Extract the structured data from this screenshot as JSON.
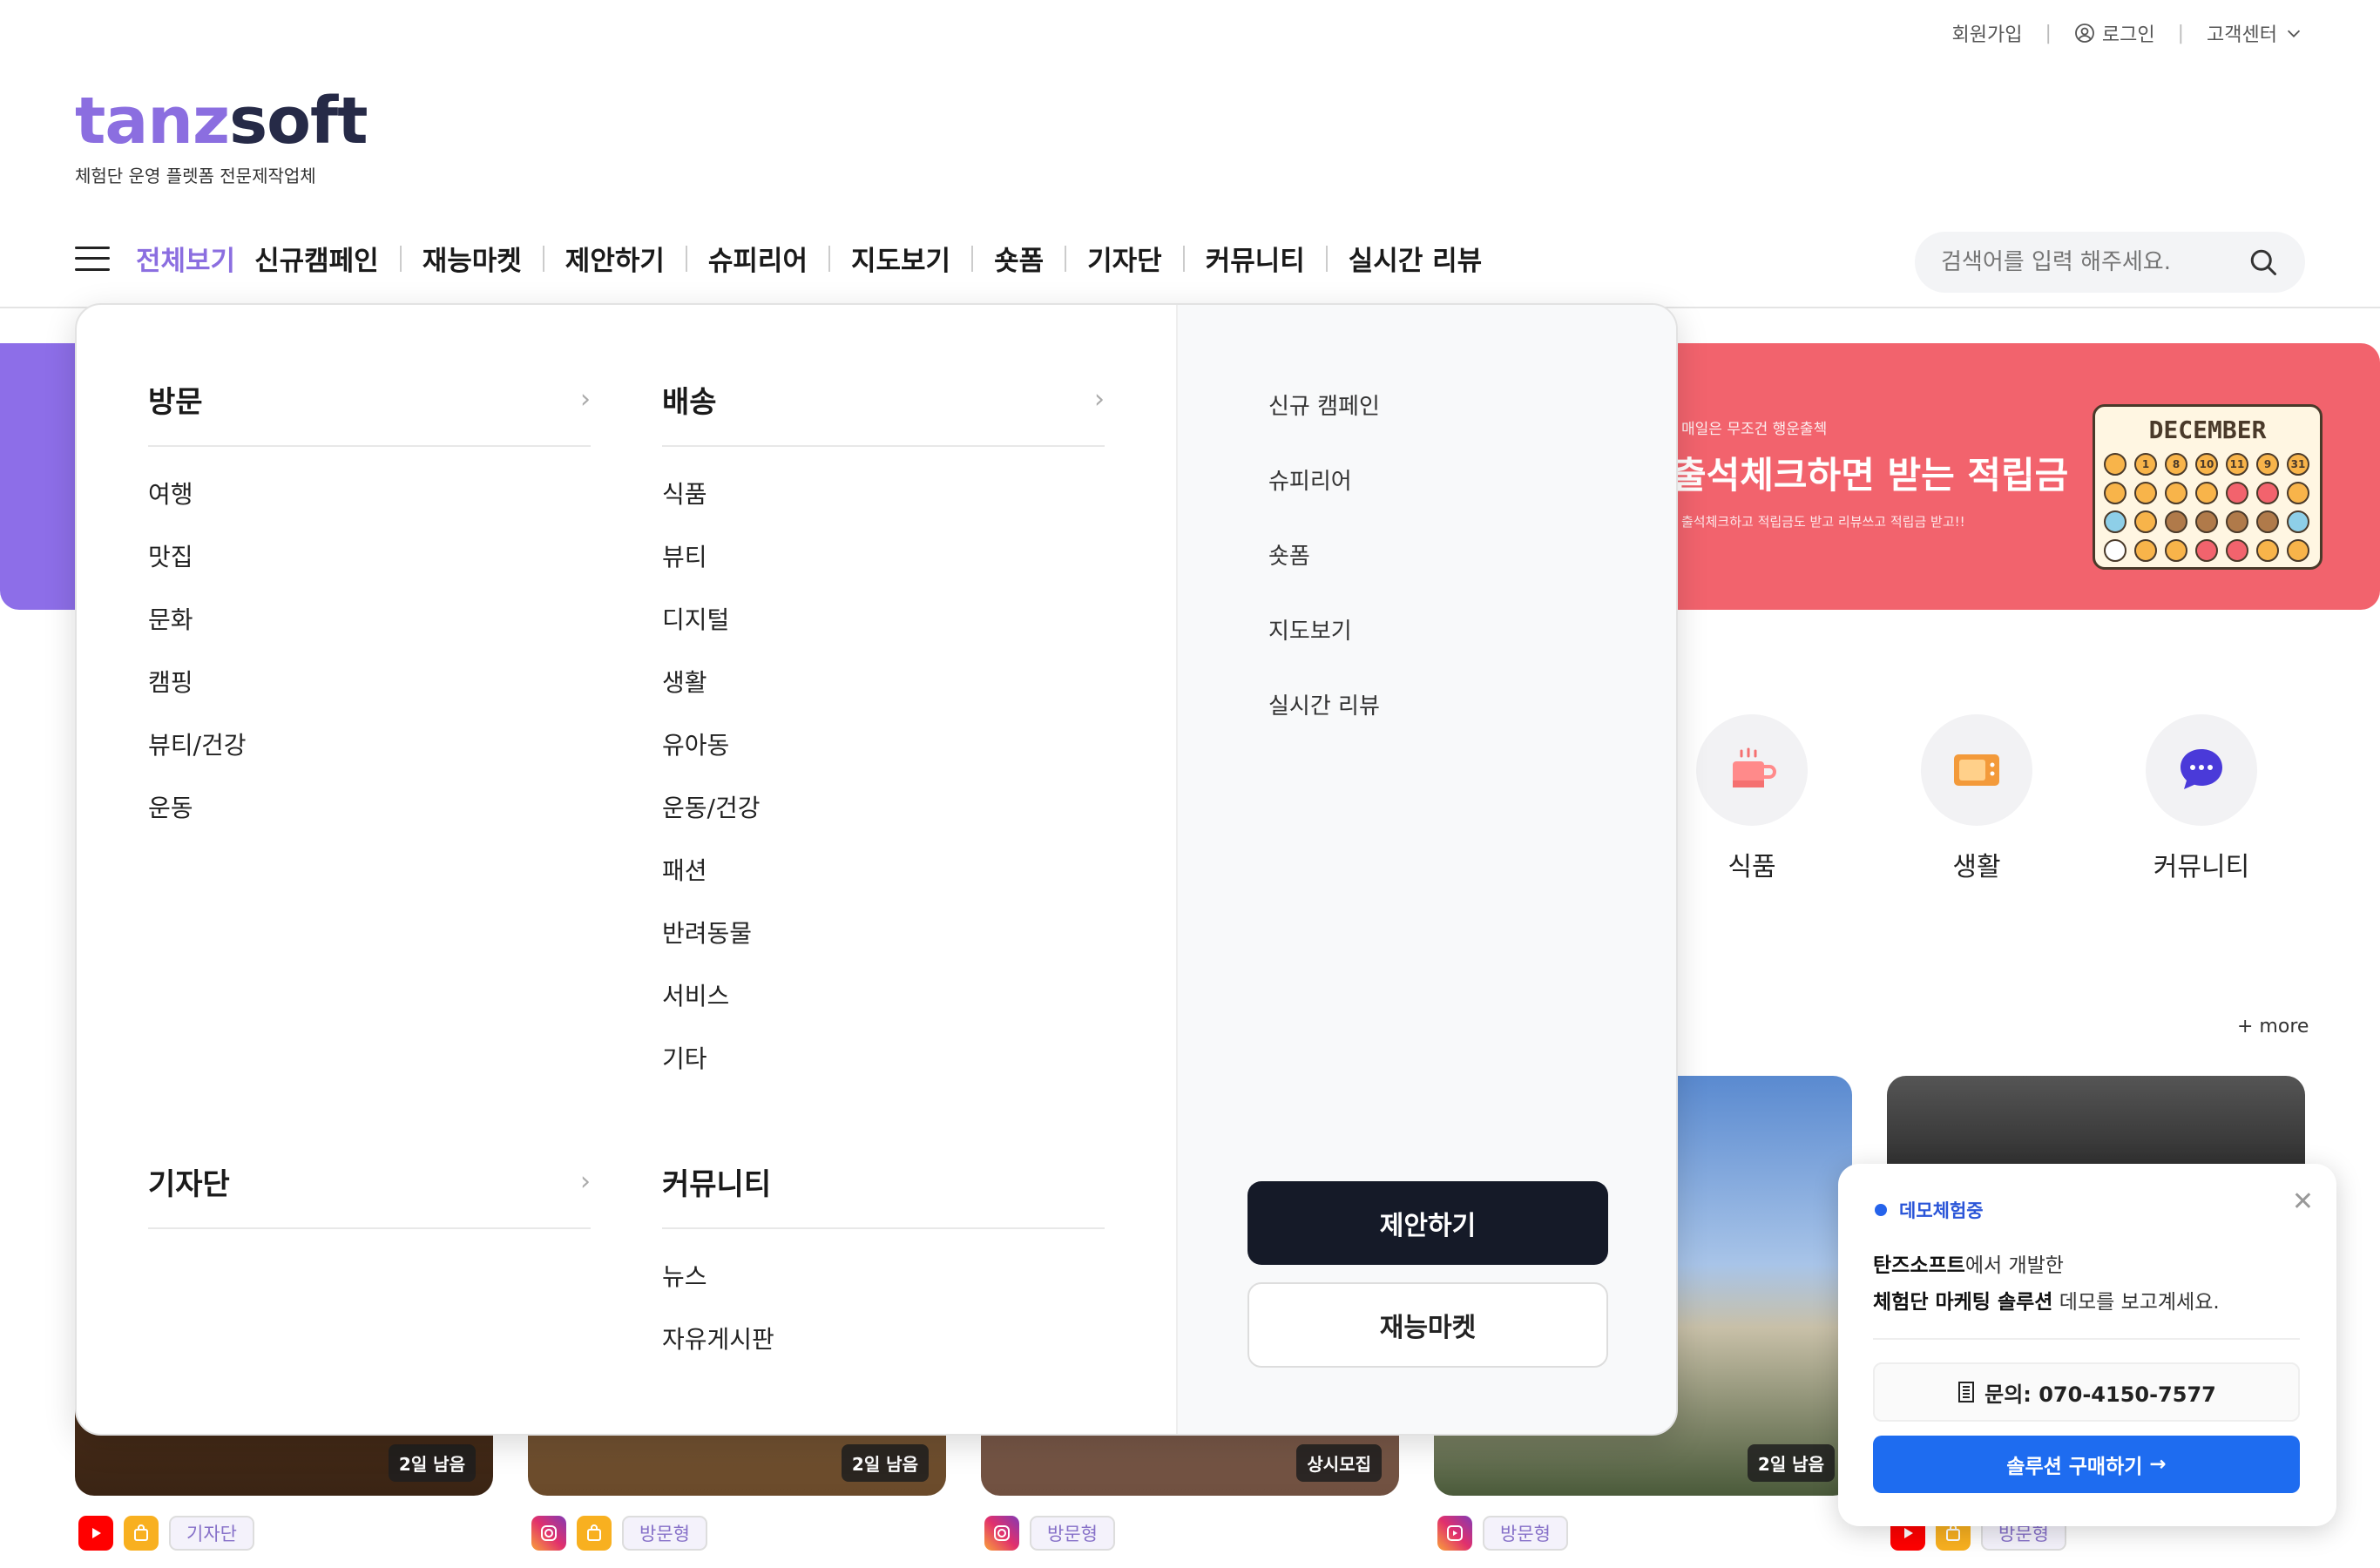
{
  "topbar": {
    "signup": "회원가입",
    "login": "로그인",
    "support": "고객센터"
  },
  "logo": {
    "part1": "tanz",
    "part2": "soft",
    "tagline": "체험단 운영 플렛폼 전문제작업체"
  },
  "nav": {
    "items": [
      "전체보기",
      "신규캠페인",
      "재능마켓",
      "제안하기",
      "슈피리어",
      "지도보기",
      "숏폼",
      "기자단",
      "커뮤니티",
      "실시간 리뷰"
    ],
    "active_index": 0
  },
  "search": {
    "placeholder": "검색어를 입력 해주세요."
  },
  "banner": {
    "small": "매일은 무조건 행운출첵",
    "title": "출석체크하면 받는 적립금",
    "sub": "출석체크하고 적립금도 받고 리뷰쓰고 적립금 받고!!",
    "calendar_title": "DECEMBER",
    "calendar_days": [
      "1",
      "8",
      "10",
      "11",
      "9",
      "31"
    ]
  },
  "categories": [
    {
      "label": "식품",
      "icon": "cup-icon"
    },
    {
      "label": "생활",
      "icon": "microwave-icon"
    },
    {
      "label": "커뮤니티",
      "icon": "chat-bubble-icon"
    }
  ],
  "more": "+ more",
  "cards": [
    {
      "badge": "2일 남음",
      "tag": "기자단",
      "channel": "youtube"
    },
    {
      "badge": "2일 남음",
      "tag": "방문형",
      "channel": "instagram"
    },
    {
      "badge": "상시모집",
      "tag": "방문형",
      "channel": "instagram"
    },
    {
      "badge": "2일 남음",
      "tag": "방문형",
      "channel": "reels"
    },
    {
      "badge": "",
      "tag": "방문형",
      "channel": "youtube"
    }
  ],
  "mega": {
    "visit": {
      "title": "방문",
      "items": [
        "여행",
        "맛집",
        "문화",
        "캠핑",
        "뷰티/건강",
        "운동"
      ]
    },
    "delivery": {
      "title": "배송",
      "items": [
        "식품",
        "뷰티",
        "디지털",
        "생활",
        "유아동",
        "운동/건강",
        "패션",
        "반려동물",
        "서비스",
        "기타"
      ]
    },
    "reporter": {
      "title": "기자단",
      "items": []
    },
    "community": {
      "title": "커뮤니티",
      "items": [
        "뉴스",
        "자유게시판"
      ]
    },
    "right_links": [
      "신규 캠페인",
      "슈피리어",
      "숏폼",
      "지도보기",
      "실시간 리뷰"
    ],
    "propose_button": "제안하기",
    "talent_button": "재능마켓"
  },
  "demo": {
    "header": "데모체험중",
    "line1_bold": "탄즈소프트",
    "line1_rest": "에서 개발한",
    "line2_bold": "체험단 마케팅 솔루션",
    "line2_rest": " 데모를 보고계세요.",
    "phone": "문의: 070-4150-7577",
    "buy": "솔루션 구매하기"
  },
  "colors": {
    "accent": "#8b6ee0",
    "banner_red": "#f2636d",
    "banner_purple": "#8d6ee8",
    "dark_button": "#151a28",
    "blue_button": "#1e6cf0"
  }
}
